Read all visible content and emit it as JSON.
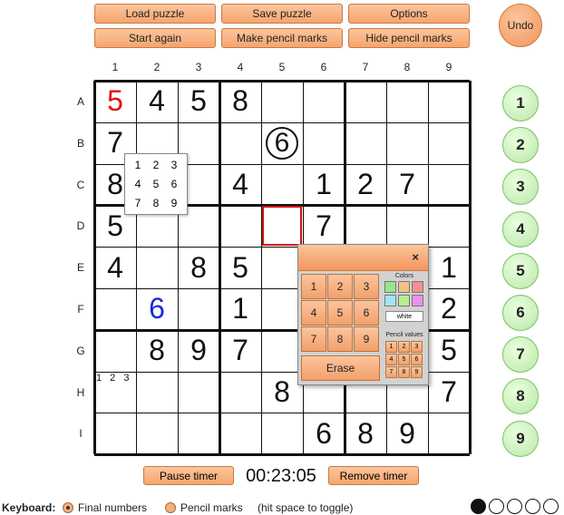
{
  "toolbar": {
    "load": "Load puzzle",
    "save": "Save puzzle",
    "options": "Options",
    "start_again": "Start again",
    "make_pencil": "Make pencil marks",
    "hide_pencil": "Hide pencil marks",
    "undo": "Undo"
  },
  "columns": [
    "1",
    "2",
    "3",
    "4",
    "5",
    "6",
    "7",
    "8",
    "9"
  ],
  "rows": [
    "A",
    "B",
    "C",
    "D",
    "E",
    "F",
    "G",
    "H",
    "I"
  ],
  "grid": [
    [
      "5",
      "4",
      "5",
      "8",
      "",
      "",
      "",
      "",
      ""
    ],
    [
      "7",
      "",
      "",
      "",
      "6",
      "",
      "",
      "",
      ""
    ],
    [
      "8",
      "",
      "",
      "4",
      "",
      "1",
      "2",
      "7",
      ""
    ],
    [
      "5",
      "",
      "",
      "",
      "",
      "7",
      "",
      "",
      ""
    ],
    [
      "4",
      "",
      "8",
      "5",
      "",
      "",
      "",
      "",
      "1"
    ],
    [
      "",
      "6",
      "",
      "1",
      "",
      "",
      "",
      "",
      "2"
    ],
    [
      "",
      "8",
      "9",
      "7",
      "",
      "",
      "",
      "",
      "5"
    ],
    [
      "",
      "",
      "",
      "",
      "8",
      "",
      "",
      "",
      "7"
    ],
    [
      "",
      "",
      "",
      "",
      "",
      "6",
      "8",
      "9",
      ""
    ]
  ],
  "cell_colors": {
    "A1": "#e01010",
    "F2": "#1a2ad8"
  },
  "circled_cell": "B5",
  "selected_cell": "D5",
  "cell_pencil_marks": {
    "H1": "1 2 3"
  },
  "pencil_popup": [
    "1",
    "2",
    "3",
    "4",
    "5",
    "6",
    "7",
    "8",
    "9"
  ],
  "side_numbers": [
    "1",
    "2",
    "3",
    "4",
    "5",
    "6",
    "7",
    "8",
    "9"
  ],
  "panel": {
    "close": "×",
    "keys": [
      "1",
      "2",
      "3",
      "4",
      "5",
      "6",
      "7",
      "8",
      "9"
    ],
    "erase": "Erase",
    "colors_label": "Colors",
    "white_label": "white",
    "pencil_values_label": "Pencil values",
    "pencil_values": [
      "1",
      "2",
      "3",
      "4",
      "5",
      "6",
      "7",
      "8",
      "9"
    ],
    "swatches": [
      "#9be38e",
      "#f3c183",
      "#f48f8f",
      "#9fe6f3",
      "#b6ef8d",
      "#ef8fef"
    ]
  },
  "timer": {
    "pause": "Pause timer",
    "time": "00:23:05",
    "remove": "Remove timer"
  },
  "footer": {
    "keyboard_label": "Keyboard:",
    "final_numbers": "Final numbers",
    "pencil_marks": "Pencil marks",
    "hint": "(hit space to toggle)"
  },
  "level_dots": {
    "total": 5,
    "filled": 1
  }
}
